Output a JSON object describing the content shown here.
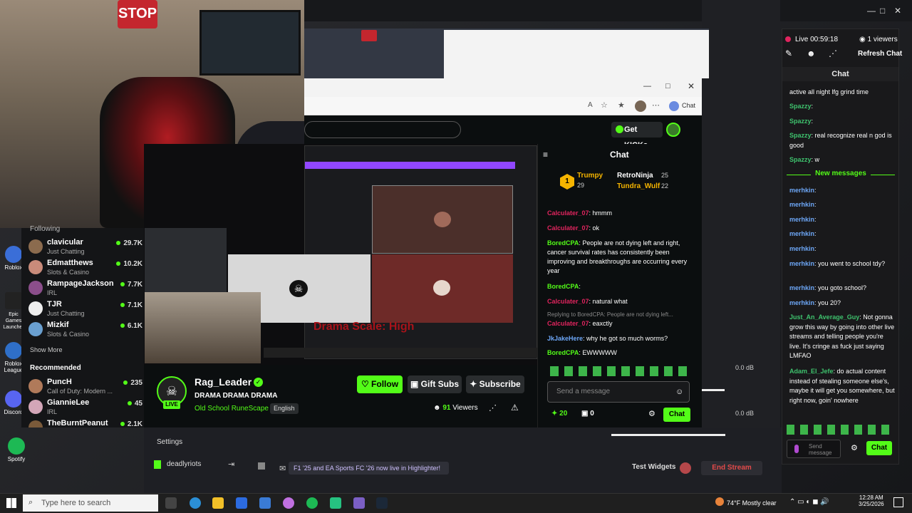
{
  "webcam": {
    "stop_sign": "STOP"
  },
  "browser": {
    "tab_chat": "Chat",
    "get_kicks": "Get KICKs",
    "inner_drama": "Drama Scale: High"
  },
  "following": {
    "title": "Following",
    "items": [
      {
        "name": "clavicular",
        "category": "Just Chatting",
        "viewers": "29.7K",
        "color": "#8b6b4e"
      },
      {
        "name": "Edmatthews",
        "category": "Slots & Casino",
        "viewers": "10.2K",
        "color": "#c98b7a"
      },
      {
        "name": "RampageJackson",
        "category": "IRL",
        "viewers": "7.7K",
        "color": "#8b4e8b"
      },
      {
        "name": "TJR",
        "category": "Just Chatting",
        "viewers": "7.1K",
        "color": "#eeeeee"
      },
      {
        "name": "Mizkif",
        "category": "Slots & Casino",
        "viewers": "6.1K",
        "color": "#6aa0d0"
      }
    ],
    "show_more": "Show More",
    "recommended_title": "Recommended",
    "recommended": [
      {
        "name": "PuncH",
        "category": "Call of Duty: Modern ...",
        "viewers": "235",
        "color": "#b07a5a"
      },
      {
        "name": "GiannieLee",
        "category": "IRL",
        "viewers": "45",
        "color": "#d3a6b8"
      },
      {
        "name": "TheBurntPeanut",
        "category": "",
        "viewers": "2.1K",
        "color": "#7a5a3a"
      }
    ]
  },
  "stream": {
    "streamer": "Rag_Leader",
    "title": "DRAMA DRAMA DRAMA",
    "category": "Old School RuneScape",
    "language": "English",
    "live": "LIVE",
    "follow": "Follow",
    "gift_subs": "Gift Subs",
    "subscribe": "Subscribe",
    "viewers_count": "91",
    "viewers_label": "Viewers"
  },
  "kick_chat": {
    "title": "Chat",
    "leaders": [
      {
        "name": "Trumpy",
        "score": "29"
      },
      {
        "name": "RetroNinja",
        "score": "25"
      },
      {
        "name": "Tundra_Wulf",
        "score": "22"
      }
    ],
    "leader_rank": "1",
    "messages": [
      {
        "user": "Calculater_07",
        "text": ": hmmm",
        "color": "#e0245e"
      },
      {
        "user": "Calculater_07",
        "text": ": ok",
        "color": "#e0245e"
      },
      {
        "user": "BoredCPA",
        "text": ": People are not dying left and right, cancer survival rates has consistently been improving and breakthroughs are occurring every year",
        "color": "#53fc18"
      },
      {
        "user": "BoredCPA",
        "text": ":",
        "color": "#53fc18"
      },
      {
        "user": "Calculater_07",
        "text": ": natural what",
        "color": "#e0245e"
      },
      {
        "user": "",
        "text": "Replying to BoredCPA: People are not dying left...",
        "color": "#888"
      },
      {
        "user": "Calculater_07",
        "text": ": eaxctly",
        "color": "#e0245e"
      },
      {
        "user": "JkJakeHere",
        "text": ": why he got so much worms?",
        "color": "#6da7f7"
      },
      {
        "user": "BoredCPA",
        "text": ": EWWWWW",
        "color": "#53fc18"
      }
    ],
    "send_placeholder": "Send a message",
    "points": "20",
    "zero": "0",
    "chat_button": "Chat"
  },
  "streamer_panel": {
    "live_time": "Live 00:59:18",
    "viewers": "1 viewers",
    "refresh_chat": "Refresh Chat",
    "chat_title": "Chat",
    "top_msgs": [
      {
        "user": "",
        "text": "active all night lfg grind time"
      },
      {
        "user": "Spazzy",
        "text": ":"
      },
      {
        "user": "Spazzy",
        "text": ":"
      },
      {
        "user": "Spazzy",
        "text": ": real recognize real n god is good"
      },
      {
        "user": "Spazzy",
        "text": ": w"
      }
    ],
    "new_messages": "New messages",
    "msgs": [
      {
        "user": "merhkin",
        "text": ":"
      },
      {
        "user": "merhkin",
        "text": ":"
      },
      {
        "user": "merhkin",
        "text": ":"
      },
      {
        "user": "merhkin",
        "text": ":"
      },
      {
        "user": "merhkin",
        "text": ":"
      },
      {
        "user": "merhkin",
        "text": ": you went to school tdy?"
      },
      {
        "user": "merhkin",
        "text": ": you goto school?"
      },
      {
        "user": "merhkin",
        "text": ": you 20?"
      },
      {
        "user": "Just_An_Average_Guy",
        "text": ": Not gonna grow this way by going into other live streams and telling people you're live. It's cringe as fuck just saying LMFAO"
      },
      {
        "user": "Adam_El_Jefe",
        "text": ": do actual content instead of stealing someone else's, maybe it will get you somewhere, but right now, goin' nowhere"
      }
    ],
    "send_placeholder": "Send message",
    "chat_button": "Chat"
  },
  "obs": {
    "settings": "Settings",
    "deadlyriots": "deadlyriots",
    "highlighter": "F1 '25 and EA Sports FC '26 now live in Highlighter!",
    "test_widgets": "Test Widgets",
    "end_stream": "End Stream",
    "db1": "0.0 dB",
    "db2": "0.0 dB"
  },
  "desktop": {
    "icons": [
      {
        "label": "Roblox"
      },
      {
        "label": "Epic Games Launcher"
      },
      {
        "label": "Roblox League"
      },
      {
        "label": "Discord"
      },
      {
        "label": "Spotify"
      }
    ]
  },
  "taskbar": {
    "search_placeholder": "Type here to search",
    "weather": "74°F  Mostly clear",
    "time": "12:28 AM",
    "date": "3/25/2026"
  },
  "colors": {
    "kick_green": "#53fc18",
    "accent_blue": "#6da7f7"
  }
}
